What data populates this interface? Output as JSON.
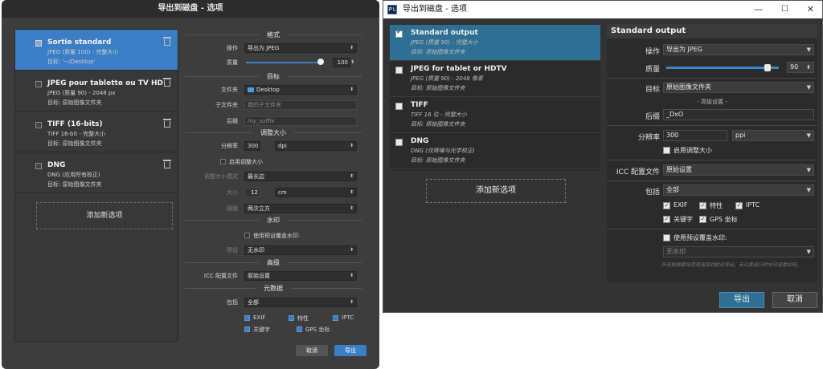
{
  "left": {
    "title": "导出到磁盘 - 选项",
    "items": [
      {
        "title": "Sortie standard",
        "line1": "JPEG (质量 100) - 完整大小",
        "line2": "目标: '~/Desktop'"
      },
      {
        "title": "JPEG pour tablette ou TV HD",
        "line1": "JPEG (质量 90) - 2048 px",
        "line2": "目标: 原始图像文件夹"
      },
      {
        "title": "TIFF (16-bits)",
        "line1": "TIFF 16-bit - 完整大小",
        "line2": "目标: 原始图像文件夹"
      },
      {
        "title": "DNG",
        "line1": "DNG (应用所有校正)",
        "line2": "目标: 原始图像文件夹"
      }
    ],
    "add_label": "添加新选项",
    "sections": {
      "format": "格式",
      "target": "目标",
      "resize": "调整大小",
      "watermark": "水印",
      "advanced": "高级",
      "metadata": "元数据"
    },
    "operation_label": "操作",
    "operation_value": "导出为 JPEG",
    "quality_label": "质量",
    "quality_value": "100",
    "quality_level": 0.97,
    "folder_label": "文件夹",
    "folder_value": "Desktop",
    "subfolder_label": "子文件夹",
    "subfolder_placeholder": "我的子文件夹",
    "suffix_label": "后缀",
    "suffix_placeholder": "my_suffix",
    "resolution_label": "分辨率",
    "resolution_value": "300",
    "resolution_unit": "dpi",
    "enable_resize_label": "启用调整大小",
    "resize_mode_label": "调整大小模式",
    "resize_mode_value": "最长边",
    "size_label": "大小",
    "size_value": "12",
    "size_unit": "cm",
    "interp_label": "插值",
    "interp_value": "两次立方",
    "use_watermark_label": "使用预设覆盖水印:",
    "preset_label": "预设",
    "preset_value": "无水印",
    "icc_label": "ICC 配置文件",
    "icc_value": "原始设置",
    "include_label": "包括",
    "include_value": "全部",
    "meta": [
      "EXIF",
      "特性",
      "IPTC",
      "关键字",
      "GPS 坐标"
    ],
    "cancel": "取消",
    "export": "导出"
  },
  "right": {
    "title": "导出到磁盘 - 选项",
    "logo": "PL",
    "items": [
      {
        "title": "Standard output",
        "line1": "JPEG (质量 90) - 完整大小",
        "line2": "目标: 原始图像文件夹"
      },
      {
        "title": "JPEG for tablet or HDTV",
        "line1": "JPEG (质量 90) - 2048 像素",
        "line2": "目标: 原始图像文件夹"
      },
      {
        "title": "TIFF",
        "line1": "TIFF 16 位 - 完整大小",
        "line2": "目标: 原始图像文件夹"
      },
      {
        "title": "DNG",
        "line1": "DNG (仅降噪与光学校正)",
        "line2": "目标: 原始图像文件夹"
      }
    ],
    "add_label": "添加新选项",
    "panel_title": "Standard output",
    "operation_label": "操作",
    "operation_value": "导出为 JPEG",
    "quality_label": "质量",
    "quality_value": "90",
    "quality_level": 0.9,
    "target_label": "目标",
    "target_value": "原始图像文件夹",
    "advanced_label": "- 高级设置 -",
    "suffix_label": "后缀",
    "suffix_value": "_DxO",
    "resolution_label": "分辨率",
    "resolution_value": "300",
    "resolution_unit": "ppi",
    "resize_label": "启用调整大小",
    "icc_label": "ICC 配置文件",
    "icc_value": "原始设置",
    "include_label": "包括",
    "include_value": "全部",
    "meta": [
      "EXIF",
      "特性",
      "IPTC",
      "关键字",
      "GPS 坐标"
    ],
    "use_watermark_label": "使用预设覆盖水印:",
    "watermark_value": "无水印",
    "note": "所有图像都将使用选择的前设导出。无论其自行的水印设置如何。",
    "export": "导出",
    "cancel": "取消"
  }
}
